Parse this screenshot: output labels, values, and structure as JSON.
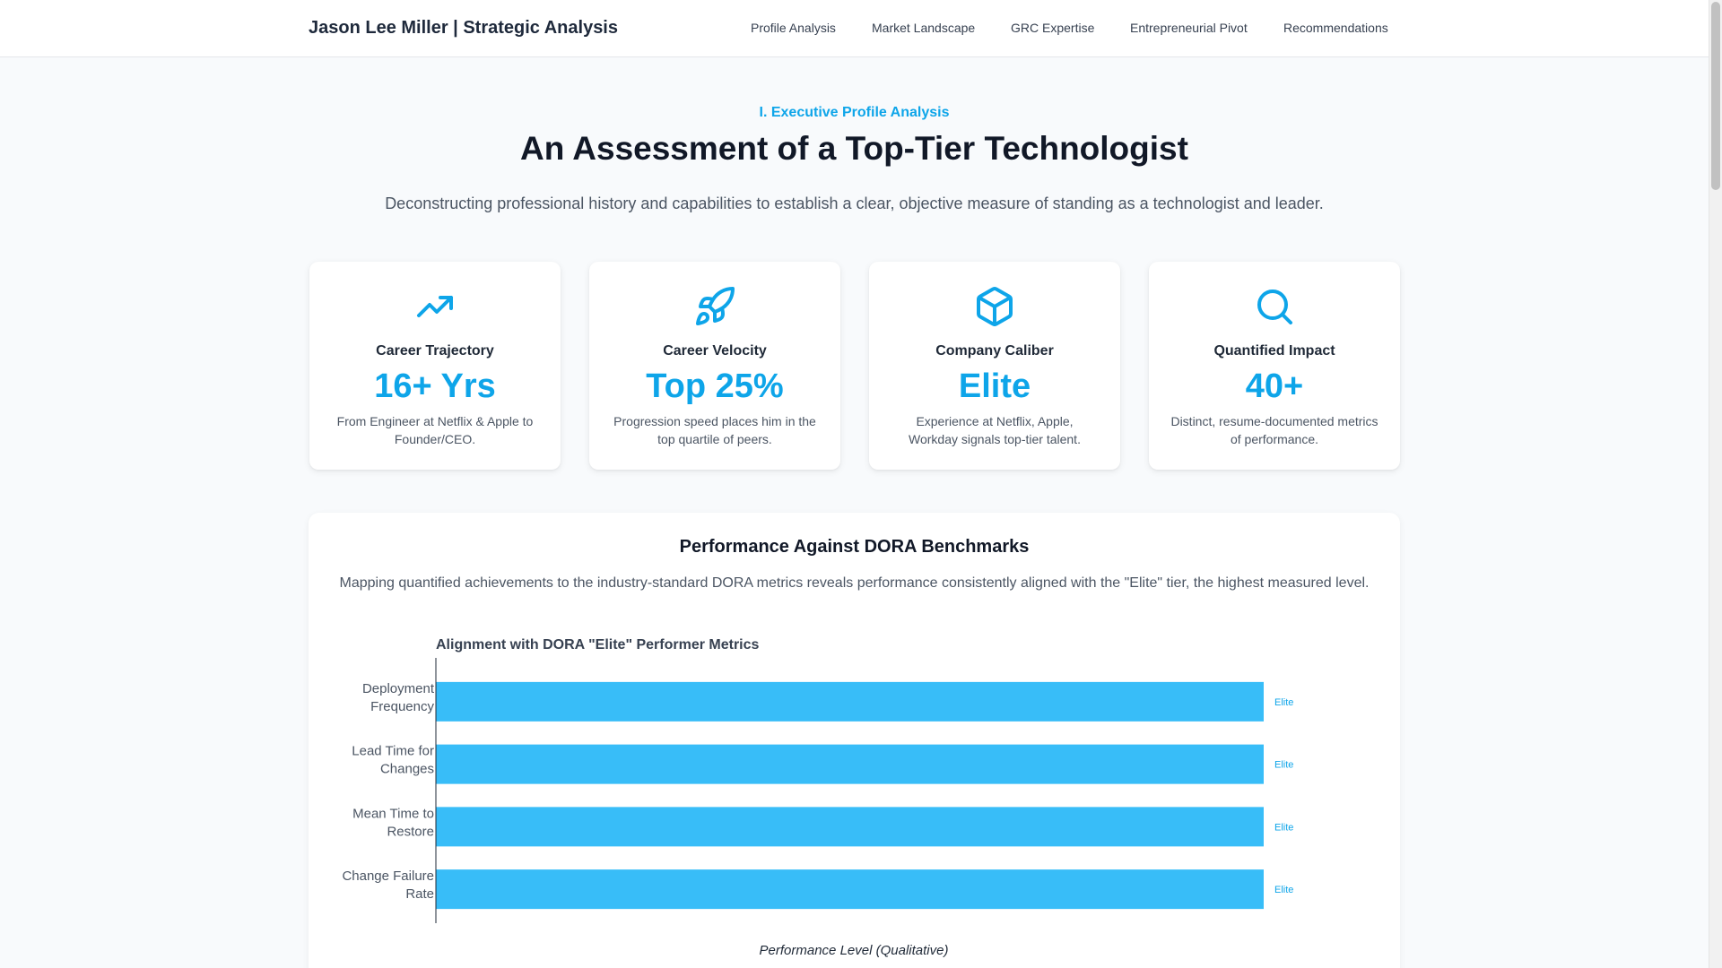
{
  "header": {
    "brand": "Jason Lee Miller | Strategic Analysis",
    "nav": [
      "Profile Analysis",
      "Market Landscape",
      "GRC Expertise",
      "Entrepreneurial Pivot",
      "Recommendations"
    ]
  },
  "hero": {
    "kicker": "I. Executive Profile Analysis",
    "title": "An Assessment of a Top-Tier Technologist",
    "subtitle": "Deconstructing professional history and capabilities to establish a clear, objective measure of standing as a technologist and leader."
  },
  "cards": [
    {
      "icon": "trending-up-icon",
      "title": "Career Trajectory",
      "value": "16+ Yrs",
      "desc": "From Engineer at Netflix & Apple to Founder/CEO."
    },
    {
      "icon": "rocket-icon",
      "title": "Career Velocity",
      "value": "Top 25%",
      "desc": "Progression speed places him in the top quartile of peers."
    },
    {
      "icon": "cube-icon",
      "title": "Company Caliber",
      "value": "Elite",
      "desc": "Experience at Netflix, Apple, Workday signals top-tier talent."
    },
    {
      "icon": "search-icon",
      "title": "Quantified Impact",
      "value": "40+",
      "desc": "Distinct, resume-documented metrics of performance."
    }
  ],
  "panel": {
    "title": "Performance Against DORA Benchmarks",
    "desc": "Mapping quantified achievements to the industry-standard DORA metrics reveals performance consistently aligned with the \"Elite\" tier, the highest measured level."
  },
  "colors": {
    "accent": "#0ea5e9",
    "bar": "#38bdf8"
  },
  "chart_data": {
    "type": "bar",
    "orientation": "horizontal",
    "title": "Alignment with DORA \"Elite\" Performer Metrics",
    "xlabel": "Performance Level (Qualitative)",
    "categories": [
      [
        "Deployment",
        "Frequency"
      ],
      [
        "Lead Time for",
        "Changes"
      ],
      [
        "Mean Time to",
        "Restore"
      ],
      [
        "Change Failure",
        "Rate"
      ]
    ],
    "values": [
      4,
      4,
      4,
      4
    ],
    "xlim": [
      0,
      4
    ],
    "data_labels": [
      "Elite",
      "Elite",
      "Elite",
      "Elite"
    ],
    "grid": false,
    "legend": "none"
  }
}
